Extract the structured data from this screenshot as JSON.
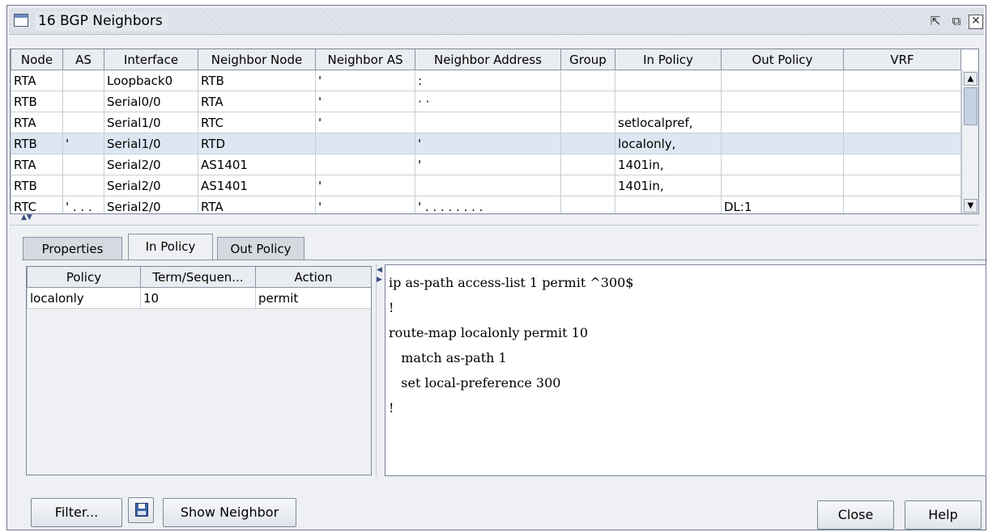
{
  "window": {
    "title": "16 BGP Neighbors",
    "restore_glyph": "⇱",
    "maximize_glyph": "⧉",
    "close_glyph": "✕"
  },
  "neighbors_table": {
    "columns": [
      "Node",
      "AS",
      "Interface",
      "Neighbor Node",
      "Neighbor AS",
      "Neighbor Address",
      "Group",
      "In Policy",
      "Out Policy",
      "VRF"
    ],
    "rows": [
      {
        "node": "RTA",
        "as": "",
        "interface": "Loopback0",
        "neighbor_node": "RTB",
        "neighbor_as": "'",
        "neighbor_address": ":",
        "group": "",
        "in_policy": "",
        "out_policy": "",
        "vrf": ""
      },
      {
        "node": "RTB",
        "as": "",
        "interface": "Serial0/0",
        "neighbor_node": "RTA",
        "neighbor_as": "'",
        "neighbor_address": "· ·",
        "group": "",
        "in_policy": "",
        "out_policy": "",
        "vrf": ""
      },
      {
        "node": "RTA",
        "as": "",
        "interface": "Serial1/0",
        "neighbor_node": "RTC",
        "neighbor_as": "'",
        "neighbor_address": "",
        "group": "",
        "in_policy": "setlocalpref,",
        "out_policy": "",
        "vrf": ""
      },
      {
        "node": "RTB",
        "as": "'",
        "interface": "Serial1/0",
        "neighbor_node": "RTD",
        "neighbor_as": "",
        "neighbor_address": "'",
        "group": "",
        "in_policy": "localonly,",
        "out_policy": "",
        "vrf": ""
      },
      {
        "node": "RTA",
        "as": "",
        "interface": "Serial2/0",
        "neighbor_node": "AS1401",
        "neighbor_as": "",
        "neighbor_address": "'",
        "group": "",
        "in_policy": "1401in,",
        "out_policy": "",
        "vrf": ""
      },
      {
        "node": "RTB",
        "as": "",
        "interface": "Serial2/0",
        "neighbor_node": "AS1401",
        "neighbor_as": "'",
        "neighbor_address": "",
        "group": "",
        "in_policy": "1401in,",
        "out_policy": "",
        "vrf": ""
      },
      {
        "node": "RTC",
        "as": "' . . .",
        "interface": "Serial2/0",
        "neighbor_node": "RTA",
        "neighbor_as": "'",
        "neighbor_address": "' . . . . . . . .",
        "group": "",
        "in_policy": "",
        "out_policy": "DL:1",
        "vrf": ""
      }
    ]
  },
  "tabs": [
    "Properties",
    "In Policy",
    "Out Policy"
  ],
  "policy_table": {
    "columns": [
      "Policy",
      "Term/Sequen...",
      "Action"
    ],
    "rows": [
      {
        "policy": "localonly",
        "term": "10",
        "action": "permit"
      }
    ]
  },
  "config_lines": [
    "ip as-path access-list 1 permit ^300$",
    "!",
    "route-map localonly permit 10",
    "   match as-path 1",
    "   set local-preference 300",
    "!"
  ],
  "buttons": {
    "filter": "Filter...",
    "show_neighbor": "Show Neighbor",
    "close": "Close",
    "help": "Help"
  }
}
